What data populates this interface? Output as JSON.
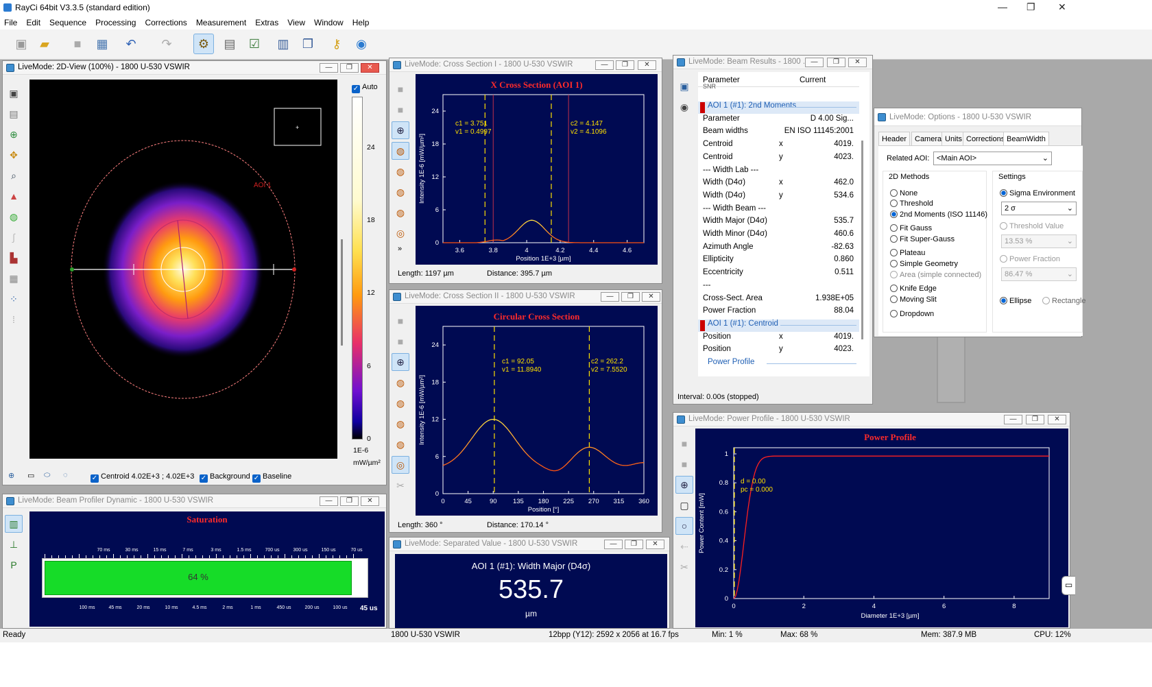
{
  "app": {
    "title": "RayCi 64bit V3.3.5 (standard edition)",
    "min": "—",
    "max": "❐",
    "close": "✕"
  },
  "menu": [
    "File",
    "Edit",
    "Sequence",
    "Processing",
    "Corrections",
    "Measurement",
    "Extras",
    "View",
    "Window",
    "Help"
  ],
  "toolbar": {
    "icons": [
      "camera-icon",
      "open-folder-icon",
      "save-icon",
      "image-export-icon",
      "undo-icon",
      "redo-icon",
      "measurement-settings-icon",
      "notes-icon",
      "checklist-icon",
      "report-icon",
      "windows-icon",
      "key-icon",
      "help-globe-icon"
    ]
  },
  "view2d": {
    "title": "LiveMode: 2D-View (100%) - 1800 U-530 VSWIR",
    "aoi_label": "AOI 1",
    "auto": "Auto",
    "scale_ticks": [
      "24",
      "18",
      "12",
      "6",
      "0"
    ],
    "unit1": "1E-6",
    "unit2": "mW/µm²",
    "centroid": "Centroid  4.02E+3 ;  4.02E+3",
    "background": "Background",
    "baseline": "Baseline"
  },
  "dynamic": {
    "title": "LiveMode: Beam Profiler Dynamic - 1800 U-530 VSWIR",
    "heading": "Saturation",
    "percent": "64 %",
    "top_ticks": [
      "70 ms",
      "30 ms",
      "15 ms",
      "7 ms",
      "3 ms",
      "1.5 ms",
      "700 us",
      "300 us",
      "150 us",
      "70 us"
    ],
    "bottom_ticks": [
      "100 ms",
      "45 ms",
      "20 ms",
      "10 ms",
      "4.5 ms",
      "2 ms",
      "1 ms",
      "450 us",
      "200 us",
      "100 us"
    ],
    "current": "45 us",
    "fill": 0.64
  },
  "cross1": {
    "title": "LiveMode: Cross Section I - 1800 U-530 VSWIR",
    "heading": "X Cross Section (AOI 1)",
    "ylabel": "Intensity 1E-6 [mW/µm²]",
    "xlabel": "Position 1E+3 [µm]",
    "yticks": [
      "24",
      "18",
      "12",
      "6",
      "0"
    ],
    "xticks": [
      "3.6",
      "3.8",
      "4",
      "4.2",
      "4.4",
      "4.6"
    ],
    "c1": "c1 = 3.751",
    "v1": "v1 = 0.4997",
    "c2": "c2 = 4.147",
    "v2": "v2 = 4.1096",
    "length": "Length:  1197 µm",
    "distance": "Distance:  395.7 µm",
    "more": "»"
  },
  "cross2": {
    "title": "LiveMode: Cross Section II - 1800 U-530 VSWIR",
    "heading": "Circular Cross Section",
    "ylabel": "Intensity 1E-6 [mW/µm²]",
    "xlabel": "Position [°]",
    "yticks": [
      "24",
      "18",
      "12",
      "6",
      "0"
    ],
    "xticks": [
      "0",
      "45",
      "90",
      "135",
      "180",
      "225",
      "270",
      "315",
      "360"
    ],
    "c1": "c1 = 92.05",
    "v1": "v1 = 11.8940",
    "c2": "c2 = 262.2",
    "v2": "v2 = 7.5520",
    "length": "Length:  360 °",
    "distance": "Distance:  170.14 °"
  },
  "separated": {
    "title": "LiveMode: Separated Value - 1800 U-530 VSWIR",
    "label": "AOI 1 (#1): Width Major (D4σ)",
    "value": "535.7",
    "unit": "µm"
  },
  "results": {
    "title": "LiveMode: Beam Results - 1800 ...",
    "col_param": "Parameter",
    "col_current": "Current",
    "snr": "SNR",
    "rows": [
      {
        "type": "sec",
        "a": "AOI 1 (#1): 2nd Moments"
      },
      {
        "a": "Parameter",
        "b": "",
        "c": "D 4.00 Sig..."
      },
      {
        "a": "Beam widths",
        "b": "",
        "c": "EN ISO 11145:2001"
      },
      {
        "a": "Centroid",
        "b": "x",
        "c": "4019."
      },
      {
        "a": "Centroid",
        "b": "y",
        "c": "4023."
      },
      {
        "a": "--- Width Lab ---",
        "b": "",
        "c": ""
      },
      {
        "a": "Width (D4σ)",
        "b": "x",
        "c": "462.0"
      },
      {
        "a": "Width (D4σ)",
        "b": "y",
        "c": "534.6"
      },
      {
        "a": "--- Width Beam ---",
        "b": "",
        "c": ""
      },
      {
        "a": "Width Major (D4σ)",
        "b": "",
        "c": "535.7"
      },
      {
        "a": "Width Minor (D4σ)",
        "b": "",
        "c": "460.6"
      },
      {
        "a": "Azimuth Angle",
        "b": "",
        "c": "-82.63"
      },
      {
        "a": "Ellipticity",
        "b": "",
        "c": "0.860"
      },
      {
        "a": "Eccentricity",
        "b": "",
        "c": "0.511"
      },
      {
        "a": "---",
        "b": "",
        "c": ""
      },
      {
        "a": "Cross-Sect. Area",
        "b": "",
        "c": "1.938E+05"
      },
      {
        "a": "Power Fraction",
        "b": "",
        "c": "88.04"
      },
      {
        "type": "sec",
        "a": "AOI 1 (#1): Centroid"
      },
      {
        "a": "Position",
        "b": "x",
        "c": "4019."
      },
      {
        "a": "Position",
        "b": "y",
        "c": "4023."
      },
      {
        "type": "link",
        "a": "Power Profile"
      }
    ],
    "interval": "Interval:  0.00s (stopped)"
  },
  "options": {
    "title": "LiveMode: Options - 1800 U-530 VSWIR",
    "tabs": [
      "Header",
      "Camera",
      "Units",
      "Corrections",
      "BeamWidth"
    ],
    "related_label": "Related AOI:",
    "related_value": "<Main AOI>",
    "methods_label": "2D Methods",
    "methods": [
      {
        "label": "None",
        "on": false
      },
      {
        "label": "Threshold",
        "on": false
      },
      {
        "label": "2nd Moments (ISO 11146)",
        "on": true
      },
      {
        "label": "Fit Gauss",
        "on": false
      },
      {
        "label": "Fit Super-Gauss",
        "on": false
      },
      {
        "label": "Plateau",
        "on": false
      },
      {
        "label": "Simple Geometry",
        "on": false
      },
      {
        "label": "Area (simple connected)",
        "on": false,
        "dis": true
      },
      {
        "label": "Knife Edge",
        "on": false
      },
      {
        "label": "Moving Slit",
        "on": false
      },
      {
        "label": "Dropdown",
        "on": false
      }
    ],
    "settings_label": "Settings",
    "sigma_env": "Sigma Environment",
    "sigma_val": "2 σ",
    "thresh_label": "Threshold Value",
    "thresh_val": "13.53 %",
    "pf_label": "Power Fraction",
    "pf_val": "86.47 %",
    "ellipse": "Ellipse",
    "rect": "Rectangle"
  },
  "power": {
    "title": "LiveMode: Power Profile - 1800 U-530 VSWIR",
    "heading": "Power Profile",
    "ylabel": "Power Content [mW]",
    "xlabel": "Diameter 1E+3 [µm]",
    "yticks": [
      "1",
      "0.8",
      "0.6",
      "0.4",
      "0.2",
      "0"
    ],
    "xticks": [
      "0",
      "2",
      "4",
      "6",
      "8"
    ],
    "d": "d = 0.00",
    "pc": "pc = 0.000"
  },
  "status": {
    "ready": "Ready",
    "camera": "1800 U-530 VSWIR",
    "format": "12bpp (Y12): 2592 x 2056 at 16.7 fps",
    "min": "Min:  1 %",
    "max": "Max:  68 %",
    "mem": "Mem: 387.9 MB",
    "cpu": "CPU: 12%"
  }
}
